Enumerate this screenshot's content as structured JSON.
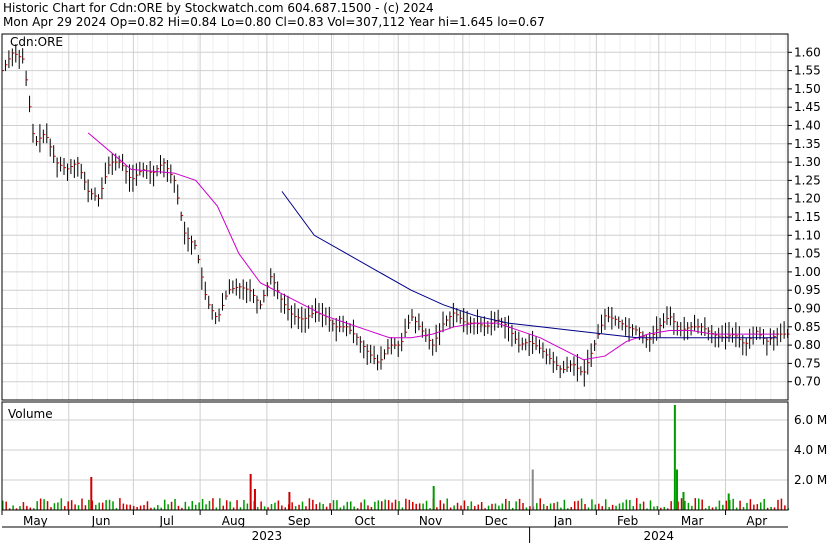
{
  "header": {
    "line1": "Historic Chart for Cdn:ORE by Stockwatch.com 604.687.1500 - (c) 2024",
    "line2": "Mon Apr 29 2024  Op=0.82  Hi=0.84  Lo=0.80  Cl=0.83  Vol=307,112  Year hi=1.645  lo=0.67"
  },
  "chart_data": [
    {
      "type": "line",
      "title": "Cdn:ORE",
      "ylim": [
        0.65,
        1.65
      ],
      "yticks": [
        "0.70",
        "0.75",
        "0.80",
        "0.85",
        "0.90",
        "0.95",
        "1.00",
        "1.05",
        "1.10",
        "1.15",
        "1.20",
        "1.25",
        "1.30",
        "1.35",
        "1.40",
        "1.45",
        "1.50",
        "1.55",
        "1.60"
      ],
      "xlabels": [
        "May",
        "Jun",
        "Jul",
        "Aug",
        "Sep",
        "Oct",
        "Nov",
        "Dec",
        "Jan",
        "Feb",
        "Mar",
        "Apr"
      ],
      "years": [
        "2023",
        "2024"
      ],
      "grid": true,
      "series": [
        {
          "role": "price",
          "color": "#cc0000",
          "x": [
            0,
            5,
            10,
            15,
            20,
            25,
            30,
            35,
            40,
            45,
            50,
            55,
            60,
            65,
            70,
            75,
            80,
            85,
            90,
            95,
            100,
            105,
            110,
            115,
            120,
            125,
            130,
            135,
            140,
            145,
            150,
            155,
            160,
            165,
            170,
            175,
            180,
            185,
            190,
            195,
            200,
            205,
            210,
            215,
            220,
            225,
            230,
            235,
            240,
            245,
            250,
            255,
            260,
            265,
            270,
            275,
            280,
            285,
            290,
            295,
            300,
            305,
            310,
            315,
            320,
            325,
            330,
            335,
            340,
            345,
            350,
            355,
            360
          ],
          "values": [
            1.55,
            1.6,
            1.58,
            1.35,
            1.38,
            1.3,
            1.28,
            1.3,
            1.22,
            1.2,
            1.3,
            1.3,
            1.25,
            1.28,
            1.27,
            1.3,
            1.25,
            1.1,
            1.07,
            0.92,
            0.87,
            0.95,
            0.96,
            0.95,
            0.91,
            0.99,
            0.92,
            0.88,
            0.87,
            0.89,
            0.88,
            0.85,
            0.85,
            0.82,
            0.78,
            0.75,
            0.8,
            0.8,
            0.88,
            0.84,
            0.8,
            0.86,
            0.89,
            0.86,
            0.86,
            0.85,
            0.87,
            0.85,
            0.8,
            0.81,
            0.79,
            0.76,
            0.73,
            0.75,
            0.72,
            0.8,
            0.88,
            0.87,
            0.85,
            0.84,
            0.81,
            0.85,
            0.88,
            0.84,
            0.85,
            0.85,
            0.83,
            0.82,
            0.83,
            0.8,
            0.84,
            0.81,
            0.83
          ]
        },
        {
          "role": "short moving average",
          "color": "#cc00cc",
          "x": [
            40,
            60,
            80,
            90,
            100,
            110,
            120,
            130,
            140,
            150,
            160,
            170,
            180,
            190,
            200,
            210,
            220,
            230,
            240,
            250,
            260,
            270,
            280,
            290,
            300,
            310,
            320,
            330,
            340,
            350,
            360
          ],
          "values": [
            1.38,
            1.28,
            1.27,
            1.25,
            1.18,
            1.05,
            0.97,
            0.94,
            0.91,
            0.88,
            0.86,
            0.84,
            0.82,
            0.82,
            0.83,
            0.85,
            0.86,
            0.86,
            0.84,
            0.82,
            0.79,
            0.76,
            0.77,
            0.81,
            0.83,
            0.84,
            0.84,
            0.83,
            0.83,
            0.83,
            0.83
          ]
        },
        {
          "role": "long moving average",
          "color": "#000088",
          "x": [
            130,
            145,
            160,
            175,
            190,
            205,
            220,
            235,
            250,
            265,
            280,
            295,
            310,
            325,
            340,
            360
          ],
          "values": [
            1.22,
            1.1,
            1.05,
            1.0,
            0.95,
            0.91,
            0.88,
            0.86,
            0.85,
            0.84,
            0.83,
            0.82,
            0.82,
            0.82,
            0.82,
            0.82
          ]
        }
      ]
    },
    {
      "type": "bar",
      "title": "Volume",
      "ylim": [
        0,
        7200000
      ],
      "yticks": [
        "2.0 M",
        "4.0 M",
        "6.0 M"
      ],
      "markers": [
        {
          "x": 41,
          "values": 2200000,
          "color": "#cc0000"
        },
        {
          "x": 115,
          "values": 2400000,
          "color": "#cc0000"
        },
        {
          "x": 117,
          "values": 1400000,
          "color": "#cc0000"
        },
        {
          "x": 133,
          "values": 1200000,
          "color": "#cc0000"
        },
        {
          "x": 200,
          "values": 1600000,
          "color": "#009900"
        },
        {
          "x": 246,
          "values": 2700000,
          "color": "#888888"
        },
        {
          "x": 312,
          "values": 7000000,
          "color": "#009900"
        },
        {
          "x": 313,
          "values": 2700000,
          "color": "#009900"
        },
        {
          "x": 316,
          "values": 1200000,
          "color": "#009900"
        },
        {
          "x": 337,
          "values": 1100000,
          "color": "#009900"
        }
      ]
    }
  ]
}
